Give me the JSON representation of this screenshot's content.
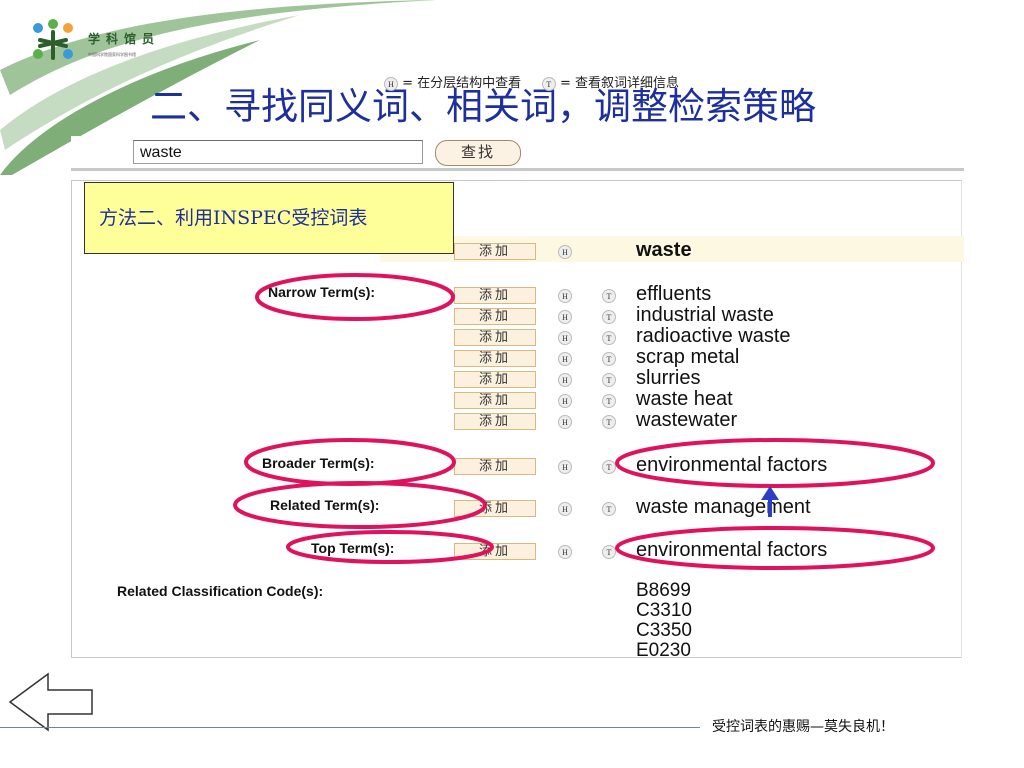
{
  "logo": {
    "name": "学科馆员",
    "subtitle": "中国科学院国家科学图书馆"
  },
  "slide": {
    "title": "二、寻找同义词、相关词，调整检索策略"
  },
  "search": {
    "value": "waste",
    "button": "查找"
  },
  "legend": {
    "h_text": "= 在分层结构中查看",
    "t_text": "= 查看叙词详细信息",
    "h_icon": "h-icon",
    "t_icon": "t-icon"
  },
  "add_label": "添加",
  "main_term": "waste",
  "labels": {
    "narrow": "Narrow Term(s):",
    "broader": "Broader Term(s):",
    "related": "Related Term(s):",
    "top": "Top Term(s):",
    "codes": "Related Classification Code(s):"
  },
  "narrow_terms": [
    "effluents",
    "industrial waste",
    "radioactive waste",
    "scrap metal",
    "slurries",
    "waste heat",
    "wastewater"
  ],
  "broader_term": "environmental factors",
  "related_term": "waste management",
  "top_term": "environmental factors",
  "codes": [
    "B8699",
    "C3310",
    "C3350",
    "E0230"
  ],
  "callout": "方法二、利用INSPEC受控词表",
  "footer": "受控词表的惠赐—莫失良机！",
  "colors": {
    "title": "#1d2f9c",
    "ellipse": "#e0125e",
    "arrow": "#2a3fc4",
    "callout_bg": "#ffff99"
  }
}
